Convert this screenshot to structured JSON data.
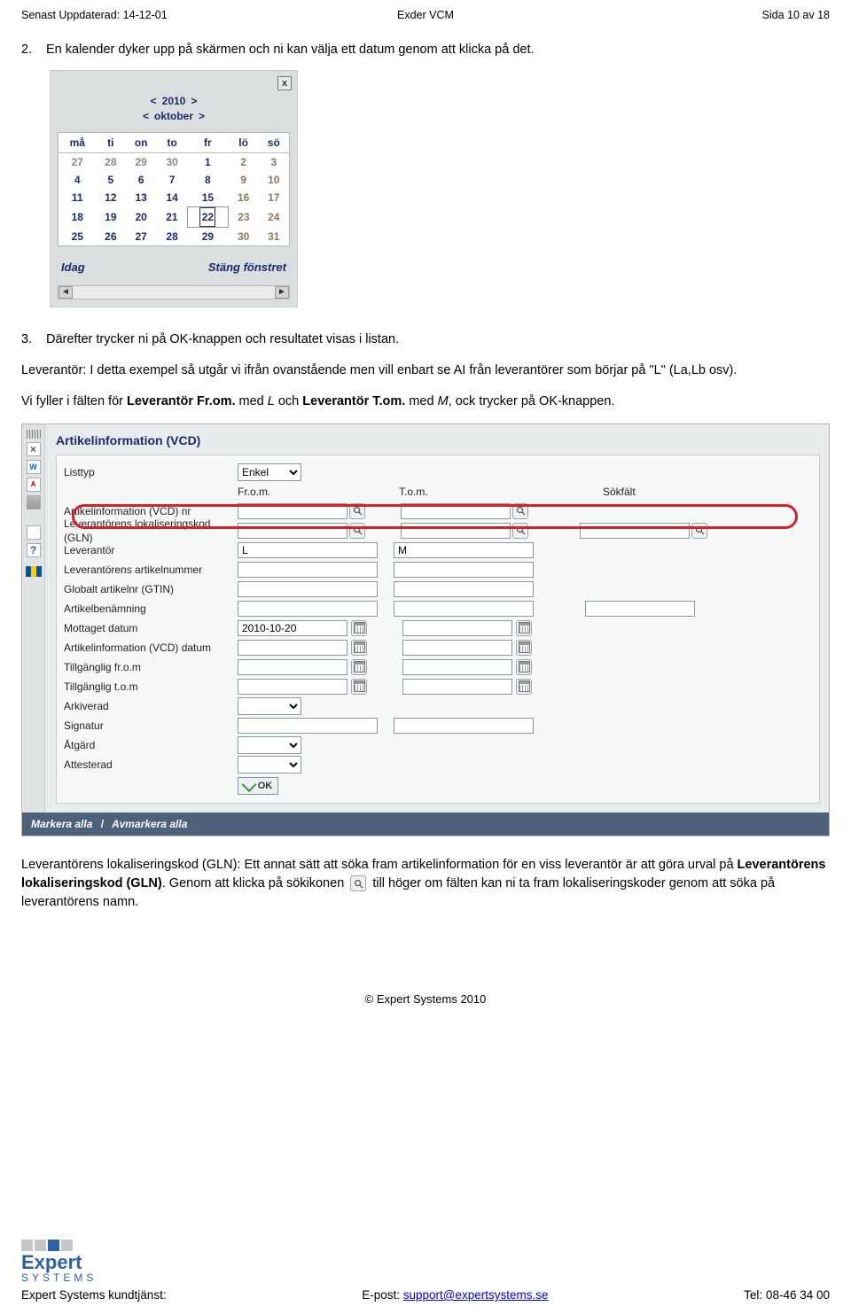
{
  "header": {
    "left": "Senast Uppdaterad: 14-12-01",
    "center": "Exder VCM",
    "right": "Sida 10 av 18"
  },
  "para": {
    "p2_num": "2.",
    "p2": "En kalender dyker upp på skärmen och ni kan välja ett datum genom att klicka på det.",
    "p3_num": "3.",
    "p3": "Därefter trycker ni på OK-knappen och resultatet visas i listan.",
    "lev1": "Leverantör: I detta exempel så utgår vi ifrån ovanstående men vill enbart se AI från leverantörer som börjar på \"L\" (La,Lb osv).",
    "lev2a": "Vi fyller i fälten för ",
    "lev2b": "Leverantör Fr.om.",
    "lev2c": " med ",
    "lev2d": "L",
    "lev2e": " och ",
    "lev2f": "Leverantör T.om.",
    "lev2g": " med ",
    "lev2h": "M",
    "lev2i": ", ock trycker på OK-knappen.",
    "gln1": "Leverantörens lokaliseringskod (GLN): Ett annat sätt att söka fram artikelinformation för en viss leverantör är att göra urval på ",
    "gln2": "Leverantörens lokaliseringskod (GLN)",
    "gln3": ". Genom att klicka på sökikonen ",
    "gln4": " till höger om fälten kan ni ta fram lokaliseringskoder genom att söka på leverantörens namn."
  },
  "calendar": {
    "close": "x",
    "year_prev": "<",
    "year": "2010",
    "year_next": ">",
    "month_prev": "<",
    "month": "oktober",
    "month_next": ">",
    "wd": [
      "må",
      "ti",
      "on",
      "to",
      "fr",
      "lö",
      "sö"
    ],
    "rows": [
      [
        "27",
        "28",
        "29",
        "30",
        "1",
        "2",
        "3"
      ],
      [
        "4",
        "5",
        "6",
        "7",
        "8",
        "9",
        "10"
      ],
      [
        "11",
        "12",
        "13",
        "14",
        "15",
        "16",
        "17"
      ],
      [
        "18",
        "19",
        "20",
        "21",
        "22",
        "23",
        "24"
      ],
      [
        "25",
        "26",
        "27",
        "28",
        "29",
        "30",
        "31"
      ]
    ],
    "today": "Idag",
    "close_win": "Stäng fönstret",
    "scroll_l": "◄",
    "scroll_r": "►"
  },
  "vcd": {
    "title": "Artikelinformation (VCD)",
    "labels": {
      "listtyp": "Listtyp",
      "ai_nr": "Artikelinformation (VCD) nr",
      "lev_gln": "Leverantörens lokaliseringskod (GLN)",
      "lev": "Leverantör",
      "lev_artnr": "Leverantörens artikelnummer",
      "gtin": "Globalt artikelnr (GTIN)",
      "benamn": "Artikelbenämning",
      "mottaget": "Mottaget datum",
      "ai_datum": "Artikelinformation (VCD) datum",
      "from": "Tillgänglig fr.o.m",
      "tom": "Tillgänglig t.o.m",
      "arkiv": "Arkiverad",
      "sign": "Signatur",
      "atg": "Åtgärd",
      "attest": "Attesterad"
    },
    "col": {
      "from": "Fr.o.m.",
      "tom": "T.o.m.",
      "sok": "Sökfält"
    },
    "sel_listtyp": "Enkel",
    "val_mottaget": "2010-10-20",
    "val_lev_from": "L",
    "val_lev_tom": "M",
    "ok": "OK",
    "footer_a": "Markera alla",
    "footer_sep": "/",
    "footer_b": "Avmarkera alla",
    "side_x": "×",
    "side_w": "W",
    "side_pdf": "A",
    "side_q": "?"
  },
  "copyright": "© Expert Systems 2010",
  "footer": {
    "left": "Expert Systems kundtjänst:",
    "center_pre": "E-post: ",
    "center_link": "support@expertsystems.se",
    "right": "Tel: 08-46 34 00",
    "logo1": "Expert",
    "logo2": "SYSTEMS"
  }
}
